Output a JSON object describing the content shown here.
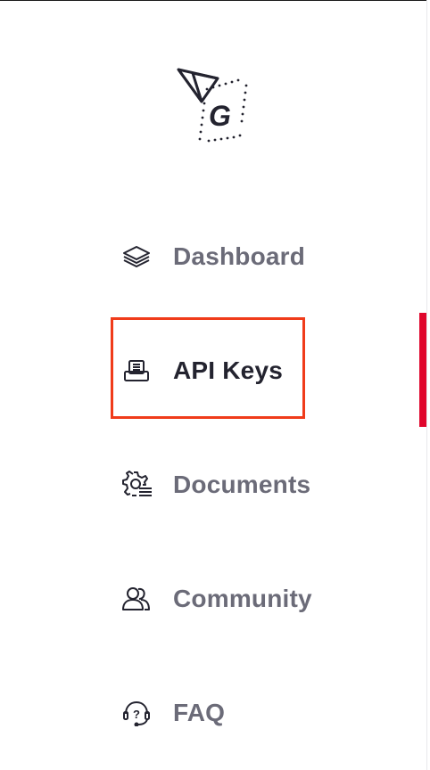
{
  "brand": {
    "logo_icon": "tron-g-logo",
    "logo_letter": "G"
  },
  "nav": {
    "items": [
      {
        "label": "Dashboard",
        "icon": "layers-icon",
        "active": false
      },
      {
        "label": "API Keys",
        "icon": "key-card-icon",
        "active": true
      },
      {
        "label": "Documents",
        "icon": "gear-document-icon",
        "active": false
      },
      {
        "label": "Community",
        "icon": "users-icon",
        "active": false
      },
      {
        "label": "FAQ",
        "icon": "help-headset-icon",
        "active": false
      }
    ]
  },
  "colors": {
    "accent": "#e0062c",
    "highlight_outline": "#f03b1a",
    "label_inactive": "#6b6b78",
    "label_active": "#23232f"
  }
}
